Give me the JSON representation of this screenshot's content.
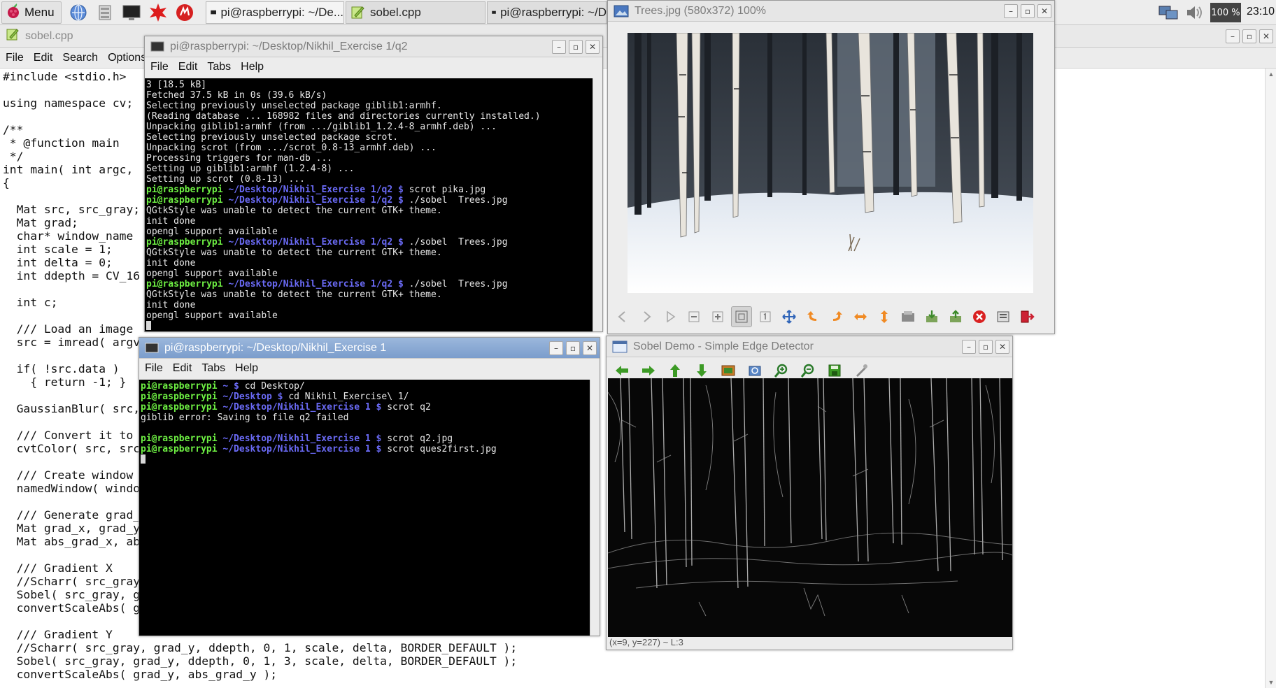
{
  "taskbar": {
    "menu_label": "Menu",
    "tasks": [
      {
        "label": "pi@raspberrypi: ~/De..."
      },
      {
        "label": "sobel.cpp"
      },
      {
        "label": "pi@raspberrypi: ~/D"
      }
    ],
    "cpu": "100 %",
    "clock": "23:10"
  },
  "editor": {
    "title": "sobel.cpp",
    "menu": [
      "File",
      "Edit",
      "Search",
      "Options"
    ],
    "lines": [
      "#include <stdio.h>",
      "",
      "using namespace cv;",
      "",
      "/**",
      " * @function main",
      " */",
      "int main( int argc,",
      "{",
      "",
      "  Mat src, src_gray;",
      "  Mat grad;",
      "  char* window_name",
      "  int scale = 1;",
      "  int delta = 0;",
      "  int ddepth = CV_16",
      "",
      "  int c;",
      "",
      "  /// Load an image",
      "  src = imread( argv",
      "",
      "  if( !src.data )",
      "    { return -1; }",
      "",
      "  GaussianBlur( src,",
      "",
      "  /// Convert it to",
      "  cvtColor( src, src",
      "",
      "  /// Create window",
      "  namedWindow( windo",
      "",
      "  /// Generate grad_",
      "  Mat grad_x, grad_y",
      "  Mat abs_grad_x, ab",
      "",
      "  /// Gradient X",
      "  //Scharr( src_gray",
      "  Sobel( src_gray, g",
      "  convertScaleAbs( g",
      "",
      "  /// Gradient Y",
      "  //Scharr( src_gray, grad_y, ddepth, 0, 1, scale, delta, BORDER_DEFAULT );",
      "  Sobel( src_gray, grad_y, ddepth, 0, 1, 3, scale, delta, BORDER_DEFAULT );",
      "  convertScaleAbs( grad_y, abs_grad_y );"
    ]
  },
  "term1": {
    "title": "pi@raspberrypi: ~/Desktop/Nikhil_Exercise 1/q2",
    "menu": [
      "File",
      "Edit",
      "Tabs",
      "Help"
    ],
    "prompt_user": "pi@raspberrypi",
    "prompt_path": "~/Desktop/Nikhil_Exercise 1/q2 $",
    "lines": [
      {
        "t": "o",
        "text": "3 [18.5 kB]"
      },
      {
        "t": "o",
        "text": "Fetched 37.5 kB in 0s (39.6 kB/s)"
      },
      {
        "t": "o",
        "text": "Selecting previously unselected package giblib1:armhf."
      },
      {
        "t": "o",
        "text": "(Reading database ... 168982 files and directories currently installed.)"
      },
      {
        "t": "o",
        "text": "Unpacking giblib1:armhf (from .../giblib1_1.2.4-8_armhf.deb) ..."
      },
      {
        "t": "o",
        "text": "Selecting previously unselected package scrot."
      },
      {
        "t": "o",
        "text": "Unpacking scrot (from .../scrot_0.8-13_armhf.deb) ..."
      },
      {
        "t": "o",
        "text": "Processing triggers for man-db ..."
      },
      {
        "t": "o",
        "text": "Setting up giblib1:armhf (1.2.4-8) ..."
      },
      {
        "t": "o",
        "text": "Setting up scrot (0.8-13) ..."
      },
      {
        "t": "p",
        "text": " scrot pika.jpg"
      },
      {
        "t": "p",
        "text": " ./sobel  Trees.jpg"
      },
      {
        "t": "o",
        "text": "QGtkStyle was unable to detect the current GTK+ theme."
      },
      {
        "t": "o",
        "text": "init done"
      },
      {
        "t": "o",
        "text": "opengl support available"
      },
      {
        "t": "p",
        "text": " ./sobel  Trees.jpg"
      },
      {
        "t": "o",
        "text": "QGtkStyle was unable to detect the current GTK+ theme."
      },
      {
        "t": "o",
        "text": "init done"
      },
      {
        "t": "o",
        "text": "opengl support available"
      },
      {
        "t": "p",
        "text": " ./sobel  Trees.jpg"
      },
      {
        "t": "o",
        "text": "QGtkStyle was unable to detect the current GTK+ theme."
      },
      {
        "t": "o",
        "text": "init done"
      },
      {
        "t": "o",
        "text": "opengl support available"
      },
      {
        "t": "c",
        "text": ""
      }
    ]
  },
  "term2": {
    "title": "pi@raspberrypi: ~/Desktop/Nikhil_Exercise 1",
    "menu": [
      "File",
      "Edit",
      "Tabs",
      "Help"
    ],
    "prompt_user": "pi@raspberrypi",
    "lines": [
      {
        "t": "p",
        "path": "~ $",
        "text": " cd Desktop/"
      },
      {
        "t": "p",
        "path": "~/Desktop $",
        "text": " cd Nikhil_Exercise\\ 1/"
      },
      {
        "t": "p",
        "path": "~/Desktop/Nikhil_Exercise 1 $",
        "text": " scrot q2"
      },
      {
        "t": "o",
        "text": "giblib error: Saving to file q2 failed"
      },
      {
        "t": "o",
        "text": ""
      },
      {
        "t": "p",
        "path": "~/Desktop/Nikhil_Exercise 1 $",
        "text": " scrot q2.jpg"
      },
      {
        "t": "p",
        "path": "~/Desktop/Nikhil_Exercise 1 $",
        "text": " scrot ques2first.jpg"
      },
      {
        "t": "c",
        "text": ""
      }
    ]
  },
  "viewer": {
    "title": "Trees.jpg (580x372) 100%",
    "toolbar": [
      "back-icon",
      "forward-icon",
      "play-icon",
      "zoom-out-icon",
      "zoom-in-icon",
      "fit-icon",
      "original-size-icon",
      "fullscreen-icon",
      "rotate-left-icon",
      "rotate-right-icon",
      "flip-horizontal-icon",
      "flip-vertical-icon",
      "open-icon",
      "save-icon",
      "save-as-icon",
      "delete-icon",
      "preferences-icon",
      "exit-icon"
    ]
  },
  "sobel": {
    "title": "Sobel Demo - Simple Edge Detector",
    "toolbar": [
      "left-arrow-icon",
      "right-arrow-icon",
      "up-arrow-icon",
      "down-arrow-icon",
      "image-icon",
      "zoom-fit-icon",
      "zoom-in-icon",
      "zoom-out-icon",
      "save-icon",
      "properties-icon"
    ],
    "status": "(x=9, y=227) ~ L:3"
  },
  "colors": {
    "prompt_user": "#6ef043",
    "prompt_path": "#6a6af5",
    "active_title": "#86a6d2",
    "terminal_bg": "#000000"
  }
}
